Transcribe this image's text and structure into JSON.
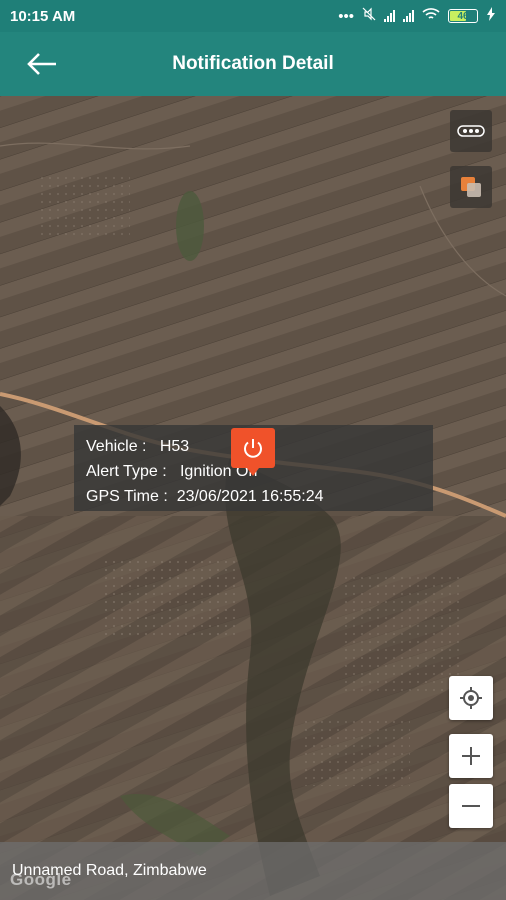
{
  "status_bar": {
    "time": "10:15 AM",
    "battery": "46",
    "icons": [
      "more-dots-icon",
      "mute-icon",
      "signal-icon",
      "signal-icon",
      "wifi-icon",
      "battery-icon",
      "charging-icon"
    ]
  },
  "header": {
    "title": "Notification Detail",
    "back_icon": "back-arrow-icon",
    "color": "#23857d"
  },
  "info": {
    "vehicle_label": "Vehicle :",
    "vehicle_value": "H53",
    "alert_label": "Alert Type :",
    "alert_value": "Ignition On",
    "gps_label": "GPS Time :",
    "gps_value": "23/06/2021 16:55:24"
  },
  "marker": {
    "icon": "power-icon",
    "color": "#f0522a"
  },
  "map": {
    "address": "Unnamed Road, Zimbabwe",
    "attribution": "Google",
    "type": "satellite"
  }
}
